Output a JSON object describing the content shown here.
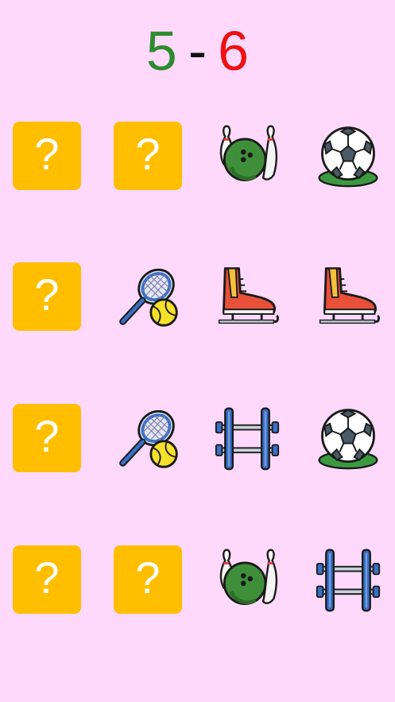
{
  "score": {
    "player1": "5",
    "separator": "-",
    "player2": "6",
    "player1_color": "#2e8b2e",
    "player2_color": "#ee1111"
  },
  "hidden_symbol": "?",
  "card_colors": {
    "hidden_bg": "#ffbf00",
    "background": "#ffd9fc"
  },
  "grid": [
    [
      "hidden",
      "hidden",
      "bowling",
      "soccer-ball"
    ],
    [
      "hidden",
      "tennis",
      "ice-skate",
      "ice-skate"
    ],
    [
      "hidden",
      "tennis",
      "dumbbell",
      "soccer-ball"
    ],
    [
      "hidden",
      "hidden",
      "bowling",
      "dumbbell"
    ]
  ]
}
